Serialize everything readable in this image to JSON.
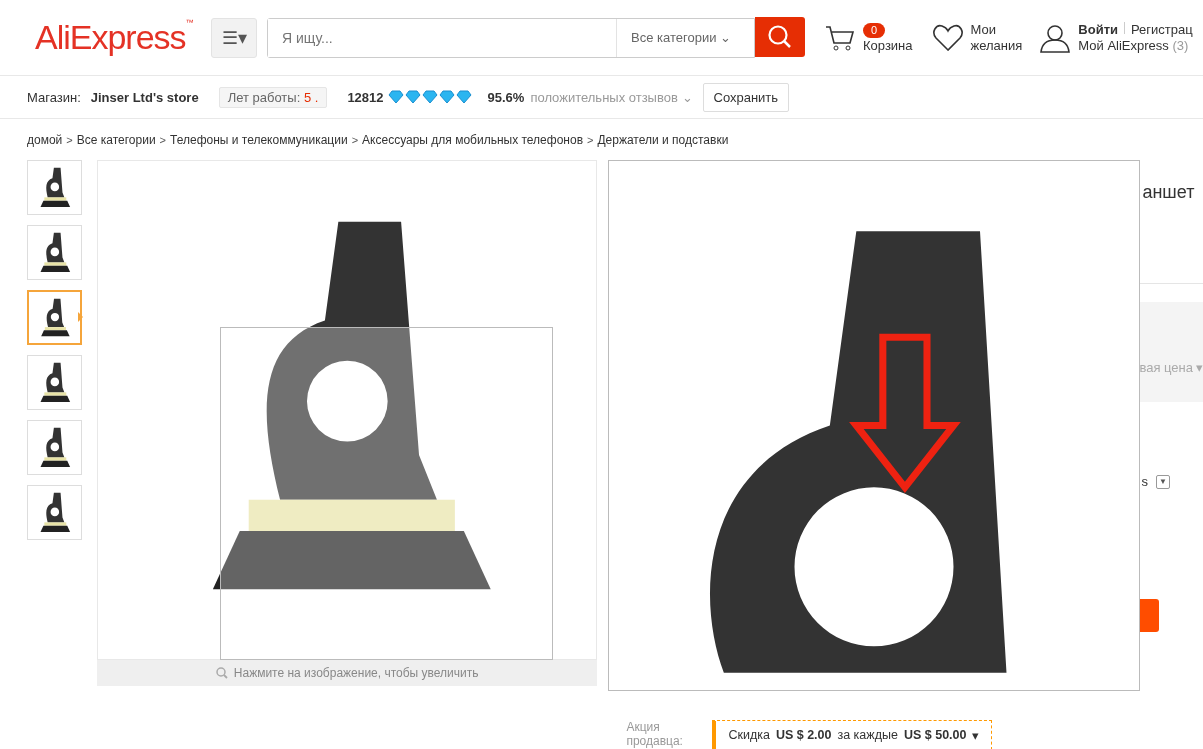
{
  "header": {
    "logo": "AliExpress",
    "logo_mark": "™",
    "menu_icon": "☰▾",
    "search": {
      "placeholder": "Я ищу...",
      "category": "Все категории",
      "category_arrow": "⌄"
    },
    "cart": {
      "count": "0",
      "label": "Корзина"
    },
    "wishlist": {
      "line1": "Мои",
      "line2": "желания"
    },
    "account": {
      "login": "Войти",
      "register": "Регистрац",
      "my": "Мой AliExpress",
      "count": "(3)"
    }
  },
  "store_bar": {
    "label": "Магазин:",
    "name": "Jinser Ltd's store",
    "years_label": "Лет работы:",
    "years": "5 .",
    "score": "12812",
    "stars": 5,
    "positive": "95.6%",
    "positive_label": "положительных отзывов",
    "positive_arrow": "⌄",
    "save": "Сохранить"
  },
  "breadcrumb": [
    {
      "kind": "link",
      "text": "домой"
    },
    {
      "kind": "separator",
      "text": ">"
    },
    {
      "kind": "link",
      "text": "Все категории"
    },
    {
      "kind": "separator",
      "text": ">"
    },
    {
      "kind": "link",
      "text": "Телефоны и телекоммуникации"
    },
    {
      "kind": "separator",
      "text": ">"
    },
    {
      "kind": "link",
      "text": "Аксессуары для мобильных телефонов"
    },
    {
      "kind": "separator",
      "text": ">"
    },
    {
      "kind": "link",
      "text": "Держатели и подставки"
    }
  ],
  "thumbnails": [
    {
      "selected": false
    },
    {
      "selected": false
    },
    {
      "selected": true
    },
    {
      "selected": false
    },
    {
      "selected": false
    },
    {
      "selected": false
    }
  ],
  "image_caption": "Нажмите на изображение, чтобы увеличить",
  "right_panel": {
    "title_fragment": "аншет",
    "price_fragment": "вая цена",
    "price_arrow": "▾",
    "option_fragment": "s",
    "option_arrow": "▼"
  },
  "promo": {
    "label": "Акция продавца:",
    "text": "Скидка **US $ 2.00** за каждые **US $ 50.00**",
    "arrow": "▾"
  }
}
